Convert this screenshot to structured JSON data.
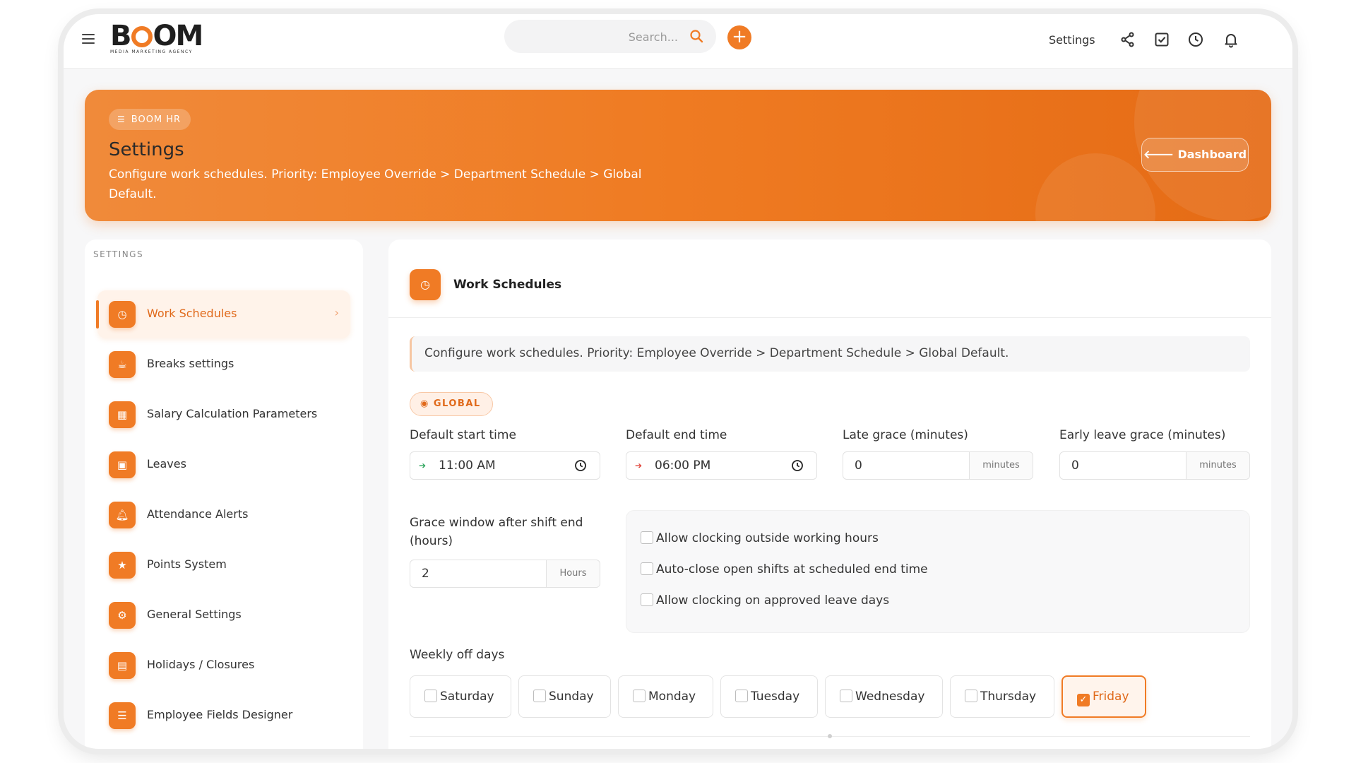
{
  "topbar": {
    "logo_text": "BOOM",
    "logo_sub": "MEDIA MARKETING AGENCY",
    "search_placeholder": "Search...",
    "settings_label": "Settings",
    "icons": [
      "share-icon",
      "task-check-icon",
      "clock-icon",
      "bell-icon"
    ]
  },
  "hero": {
    "badge": "BOOM HR",
    "title": "Settings",
    "description": "Configure work schedules. Priority: Employee Override > Department Schedule > Global Default.",
    "dashboard_button": "Dashboard"
  },
  "sidebar": {
    "title": "SETTINGS",
    "items": [
      {
        "label": "Work Schedules",
        "icon": "clock-icon",
        "active": true
      },
      {
        "label": "Breaks settings",
        "icon": "coffee-icon"
      },
      {
        "label": "Salary Calculation Parameters",
        "icon": "calculator-icon"
      },
      {
        "label": "Leaves",
        "icon": "calendar-icon"
      },
      {
        "label": "Attendance Alerts",
        "icon": "bell-icon"
      },
      {
        "label": "Points System",
        "icon": "star-icon"
      },
      {
        "label": "General Settings",
        "icon": "gear-icon"
      },
      {
        "label": "Holidays / Closures",
        "icon": "calendar-check-icon"
      },
      {
        "label": "Employee Fields Designer",
        "icon": "list-icon"
      }
    ]
  },
  "panel": {
    "title": "Work Schedules",
    "note": "Configure work schedules. Priority: Employee Override > Department Schedule > Global Default.",
    "scope_badge": "GLOBAL",
    "fields": {
      "start_label": "Default start time",
      "start_value": "11:00 AM",
      "end_label": "Default end time",
      "end_value": "06:00 PM",
      "late_label": "Late grace (minutes)",
      "late_value": "0",
      "late_unit": "minutes",
      "early_label": "Early leave grace (minutes)",
      "early_value": "0",
      "early_unit": "minutes",
      "grace_label": "Grace window after shift end (hours)",
      "grace_value": "2",
      "grace_unit": "Hours"
    },
    "options": [
      {
        "label": "Allow clocking outside working hours",
        "checked": false
      },
      {
        "label": "Auto-close open shifts at scheduled end time",
        "checked": false
      },
      {
        "label": "Allow clocking on approved leave days",
        "checked": false
      }
    ],
    "weekly_off_label": "Weekly off days",
    "days": [
      {
        "label": "Saturday",
        "checked": false
      },
      {
        "label": "Sunday",
        "checked": false
      },
      {
        "label": "Monday",
        "checked": false
      },
      {
        "label": "Tuesday",
        "checked": false
      },
      {
        "label": "Wednesday",
        "checked": false
      },
      {
        "label": "Thursday",
        "checked": false
      },
      {
        "label": "Friday",
        "checked": true
      }
    ]
  },
  "colors": {
    "accent": "#f07b25",
    "accent_text": "#e0691a"
  }
}
